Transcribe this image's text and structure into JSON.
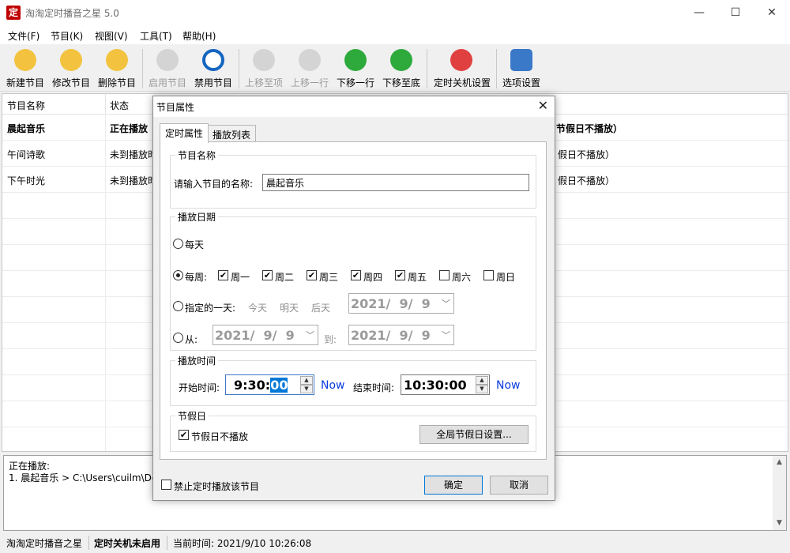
{
  "window": {
    "icon_text": "定",
    "title": "淘淘定时播音之星 5.0"
  },
  "menu": [
    "文件(F)",
    "节目(K)",
    "视图(V)",
    "工具(T)",
    "帮助(H)"
  ],
  "toolbar": [
    {
      "label": "新建节目",
      "icon": "new-program-icon",
      "enabled": true,
      "color": "#f3c340"
    },
    {
      "label": "修改节目",
      "icon": "edit-program-icon",
      "enabled": true,
      "color": "#f3c340"
    },
    {
      "label": "删除节目",
      "icon": "delete-program-icon",
      "enabled": true,
      "color": "#f3c340"
    },
    {
      "label": "启用节目",
      "icon": "play-icon",
      "enabled": false,
      "color": "#cfcfcf"
    },
    {
      "label": "禁用节目",
      "icon": "disable-icon",
      "enabled": true,
      "color": "#1565c0"
    },
    {
      "label": "上移至项",
      "icon": "move-top-icon",
      "enabled": false,
      "color": "#cfcfcf"
    },
    {
      "label": "上移一行",
      "icon": "move-up-icon",
      "enabled": false,
      "color": "#cfcfcf"
    },
    {
      "label": "下移一行",
      "icon": "move-down-icon",
      "enabled": true,
      "color": "#2eaa3c"
    },
    {
      "label": "下移至底",
      "icon": "move-bottom-icon",
      "enabled": true,
      "color": "#2eaa3c"
    },
    {
      "label": "定时关机设置",
      "icon": "power-icon",
      "enabled": true,
      "color": "#e04040"
    },
    {
      "label": "选项设置",
      "icon": "options-icon",
      "enabled": true,
      "color": "#3a78c8"
    }
  ],
  "list": {
    "columns": [
      "节目名称",
      "状态"
    ],
    "rows": [
      {
        "name": "晨起音乐",
        "status": "正在播放",
        "tail": "节假日不播放）",
        "bold": true
      },
      {
        "name": "午间诗歌",
        "status": "未到播放时",
        "tail": "假日不播放）",
        "bold": false
      },
      {
        "name": "下午时光",
        "status": "未到播放时",
        "tail": "假日不播放）",
        "bold": false
      }
    ]
  },
  "log": {
    "line1": "正在播放:",
    "line2": "1. 晨起音乐 > C:\\Users\\cuilm\\Des"
  },
  "status": {
    "app": "淘淘定时播音之星",
    "shutdown": "定时关机未启用",
    "time": "当前时间: 2021/9/10 10:26:08"
  },
  "dialog": {
    "title": "节目属性",
    "close": "✕",
    "tabs": [
      "定时属性",
      "播放列表"
    ],
    "name_group": {
      "title": "节目名称",
      "prompt": "请输入节目的名称:",
      "value": "晨起音乐"
    },
    "date_group": {
      "title": "播放日期",
      "daily": "每天",
      "weekly": "每周:",
      "days": [
        "周一",
        "周二",
        "周三",
        "周四",
        "周五",
        "周六",
        "周日"
      ],
      "days_checked": [
        true,
        true,
        true,
        true,
        true,
        false,
        false
      ],
      "specified": "指定的一天:",
      "today": "今天",
      "tomorrow": "明天",
      "day_after": "后天",
      "date1": "2021/  9/  9",
      "from": "从:",
      "from_date": "2021/  9/  9",
      "to": "到:",
      "to_date": "2021/  9/  9"
    },
    "time_group": {
      "title": "播放时间",
      "start_label": "开始时间:",
      "start_prefix": "9:30:",
      "start_selected": "00",
      "now1": "Now",
      "end_label": "结束时间:",
      "end_value": "10:30:00",
      "now2": "Now"
    },
    "holiday_group": {
      "title": "节假日",
      "skip_label": "节假日不播放",
      "settings_button": "全局节假日设置..."
    },
    "disable_label": "禁止定时播放该节目",
    "ok": "确定",
    "cancel": "取消"
  }
}
